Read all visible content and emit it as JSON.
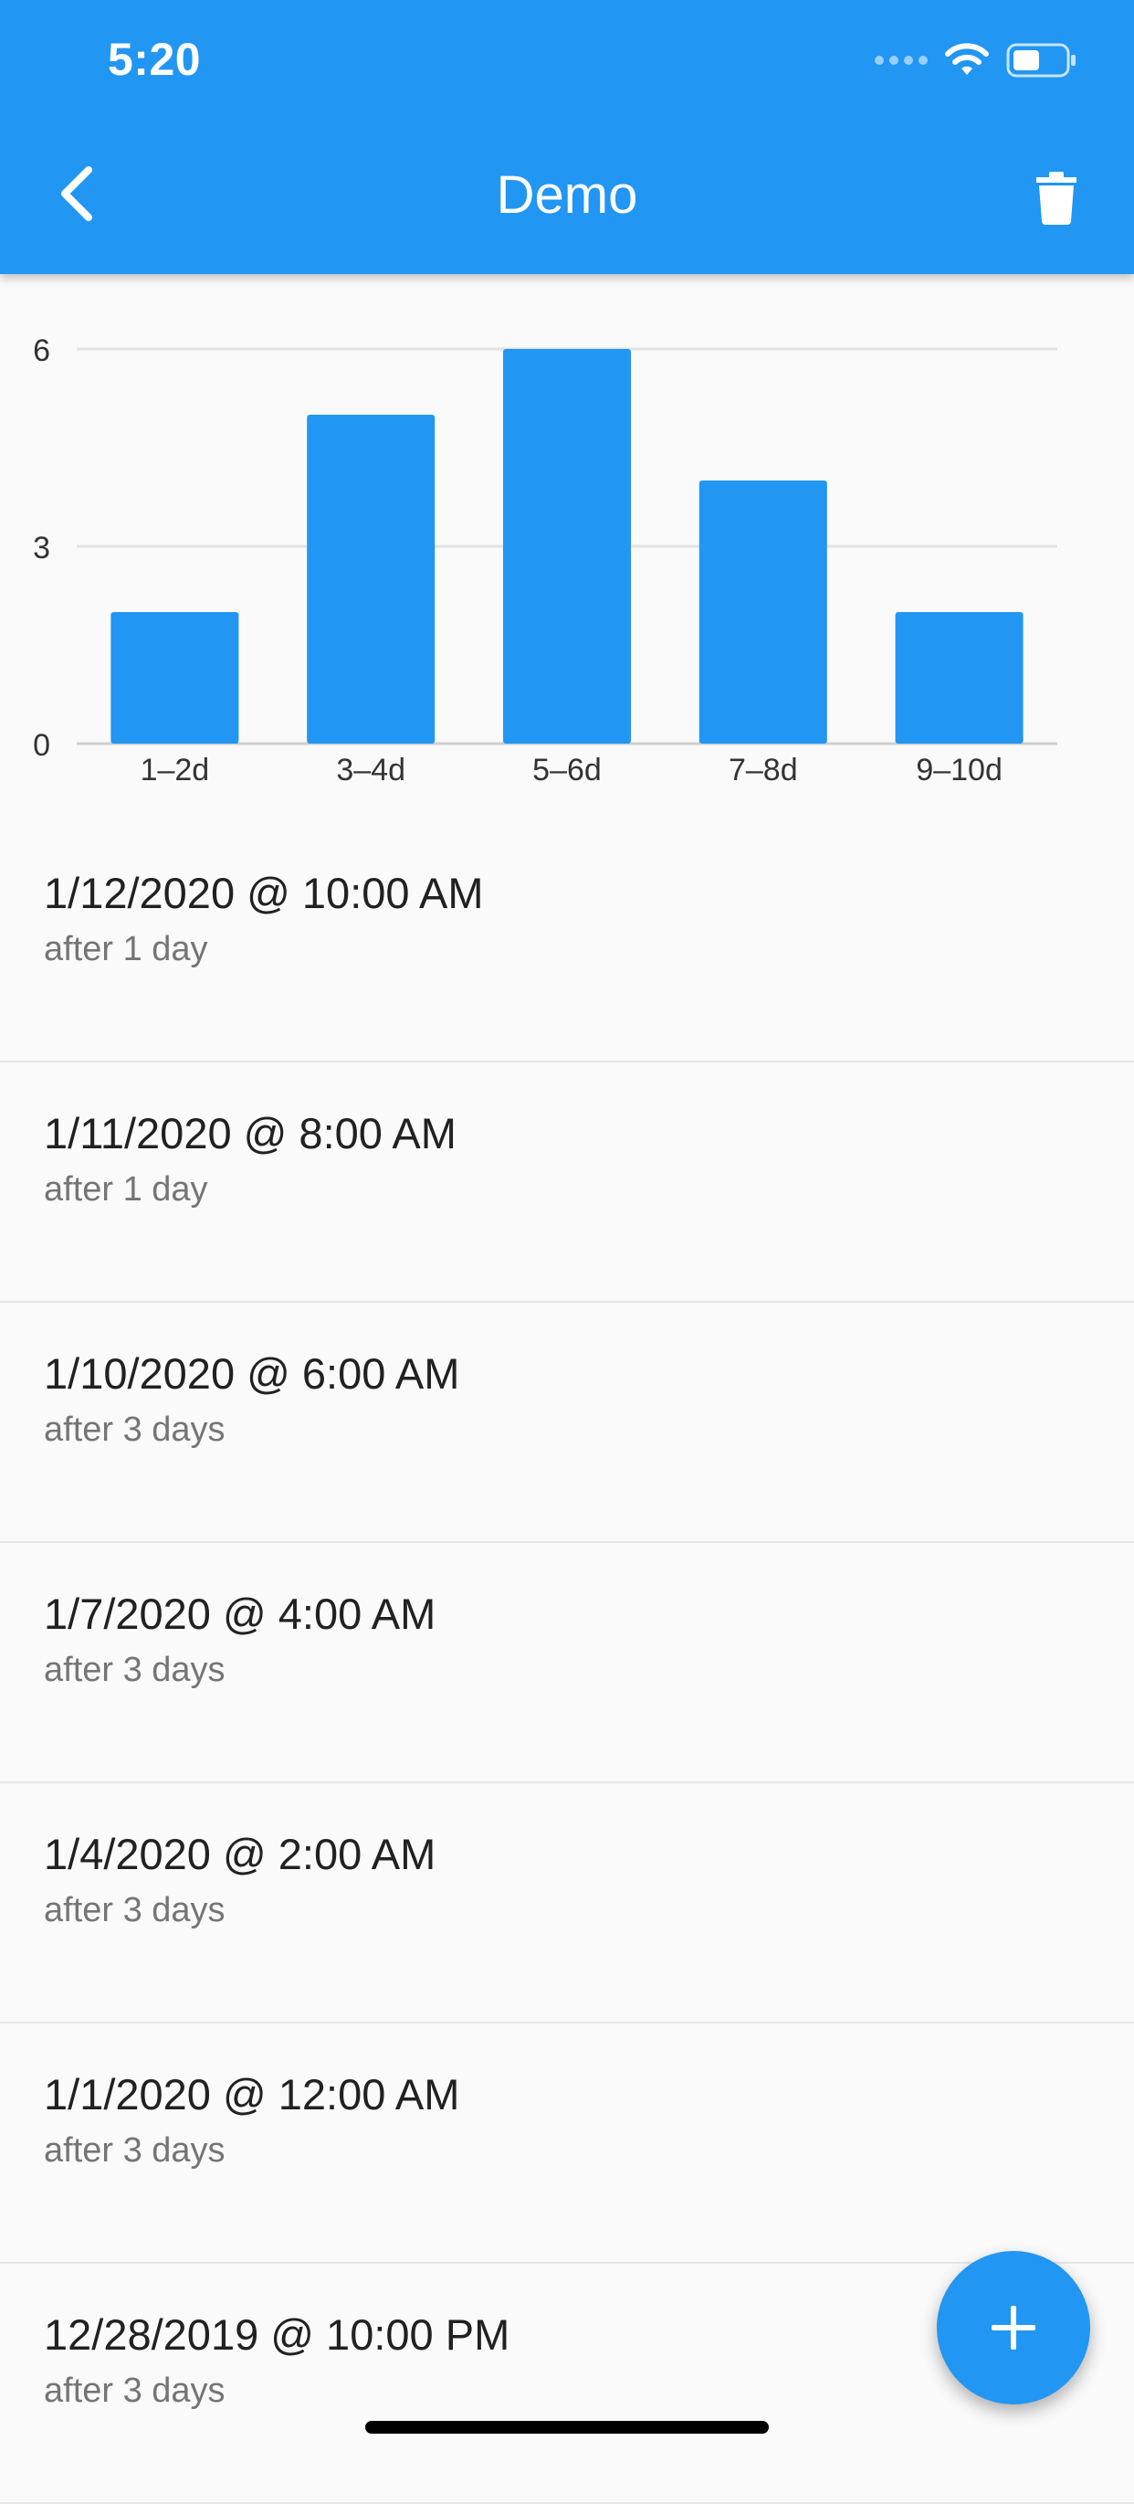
{
  "status_bar": {
    "time": "5:20",
    "icons": [
      "signal-dots-icon",
      "wifi-icon",
      "battery-icon"
    ]
  },
  "app_bar": {
    "title": "Demo",
    "back_icon": "chevron-left-icon",
    "action_icon": "trash-icon",
    "color": "#2196f3"
  },
  "chart_data": {
    "type": "bar",
    "categories": [
      "1–2d",
      "3–4d",
      "5–6d",
      "7–8d",
      "9–10d"
    ],
    "values": [
      2,
      5,
      6,
      4,
      2
    ],
    "ylim": [
      0,
      6
    ],
    "yticks": [
      "0",
      "3",
      "6"
    ],
    "grid": true,
    "bar_color": "#2196f3"
  },
  "list": {
    "items": [
      {
        "title": "1/12/2020 @ 10:00 AM",
        "subtitle": "after 1 day"
      },
      {
        "title": "1/11/2020 @ 8:00 AM",
        "subtitle": "after 1 day"
      },
      {
        "title": "1/10/2020 @ 6:00 AM",
        "subtitle": "after 3 days"
      },
      {
        "title": "1/7/2020 @ 4:00 AM",
        "subtitle": "after 3 days"
      },
      {
        "title": "1/4/2020 @ 2:00 AM",
        "subtitle": "after 3 days"
      },
      {
        "title": "1/1/2020 @ 12:00 AM",
        "subtitle": "after 3 days"
      },
      {
        "title": "12/28/2019 @ 10:00 PM",
        "subtitle": "after 3 days"
      }
    ]
  },
  "fab": {
    "icon": "plus-icon"
  }
}
